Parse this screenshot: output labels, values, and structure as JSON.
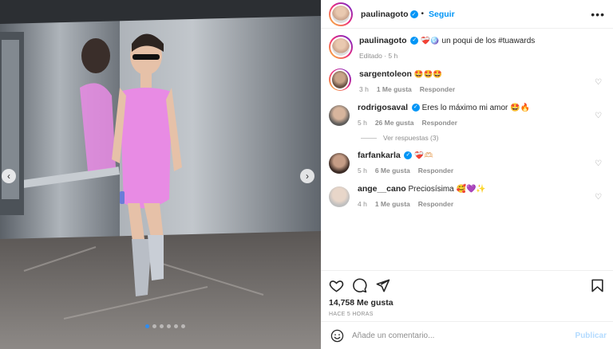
{
  "post": {
    "author": "paulinagoto",
    "follow_label": "Seguir",
    "more_label": "•••",
    "caption_author": "paulinagoto",
    "caption_emoji": "❤️‍🩹🪩",
    "caption_text": "un poqui de los #tuawards",
    "caption_meta": "Editado · 5 h"
  },
  "comments": [
    {
      "user": "sargentoleon",
      "verified": false,
      "text": "🤩🤩🤩",
      "time": "3 h",
      "likes": "1 Me gusta",
      "reply": "Responder"
    },
    {
      "user": "rodrigosaval",
      "verified": true,
      "text": "Eres lo máximo mi amor 🤩🔥",
      "time": "5 h",
      "likes": "26 Me gusta",
      "reply": "Responder"
    },
    {
      "user": "farfankarla",
      "verified": true,
      "text": "❤️‍🩹🫶🏻",
      "time": "5 h",
      "likes": "6 Me gusta",
      "reply": "Responder"
    },
    {
      "user": "ange__cano",
      "verified": false,
      "text": "Preciosísima 🥰💜✨",
      "time": "4 h",
      "likes": "1 Me gusta",
      "reply": "Responder"
    }
  ],
  "replies_label": "Ver respuestas (3)",
  "footer": {
    "likes": "14,758 Me gusta",
    "time": "HACE 5 HORAS",
    "comment_placeholder": "Añade un comentario...",
    "publish_label": "Publicar"
  },
  "colors": {
    "accent": "#0095f6",
    "dress": "#e88be4",
    "elevator": "#9aa1a8"
  }
}
